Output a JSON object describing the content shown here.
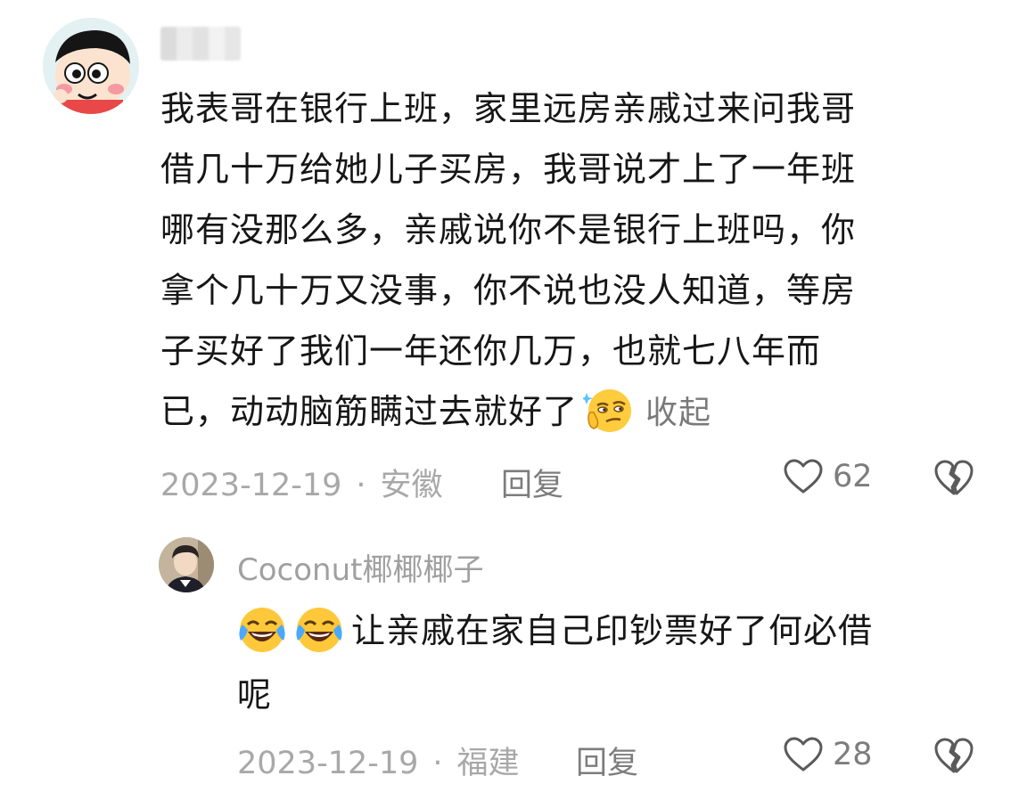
{
  "comment1": {
    "username": "",
    "lines": [
      "我表哥在银行上班，家里远房亲戚过来问我哥",
      "借几十万给她儿子买房，我哥说才上了一年班",
      "哪有没那么多，亲戚说你不是银行上班吗，你",
      "拿个几十万又没事，你不说也没人知道，等房",
      "子买好了我们一年还你几万，也就七八年而",
      "已，动动脑筋瞒过去就好了"
    ],
    "collapse_label": "收起",
    "date": "2023-12-19",
    "location": "安徽",
    "separator": "·",
    "reply_label": "回复",
    "like_count": "62",
    "emoji_icon": "thinking-smirk-emoji"
  },
  "comment2": {
    "username": "Coconut椰椰椰子",
    "lines": [
      "让亲戚在家自己印钞票好了何必借",
      "呢"
    ],
    "date": "2023-12-19",
    "location": "福建",
    "separator": "·",
    "reply_label": "回复",
    "like_count": "28",
    "emoji_icon": "crying-laughing-emoji"
  },
  "colors": {
    "text": "#161616",
    "meta": "#a8a8a8",
    "action": "#7d7d7d"
  }
}
